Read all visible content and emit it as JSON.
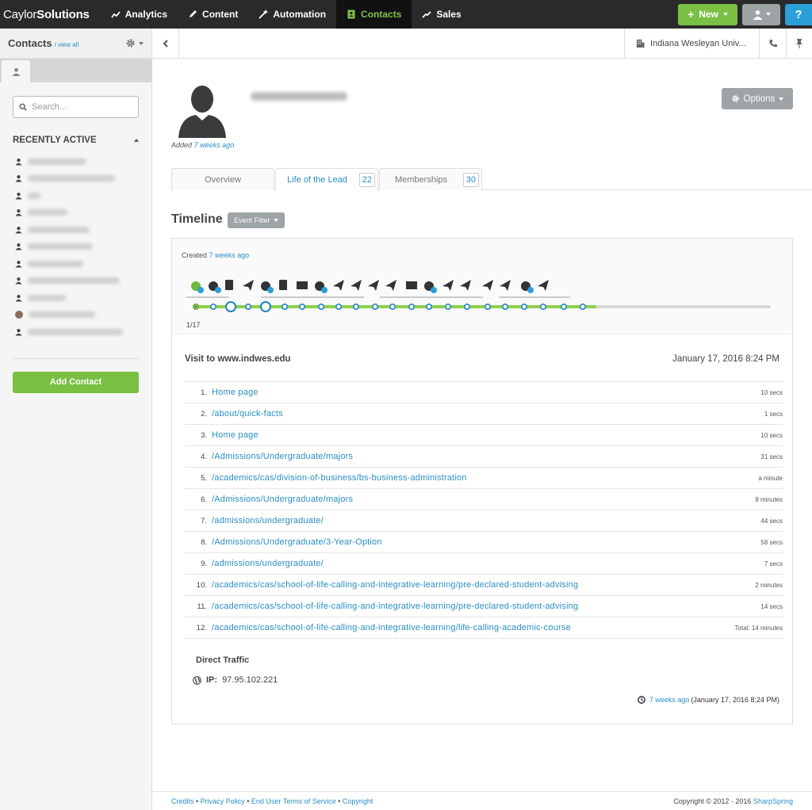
{
  "app": {
    "brand_light": "Caylor",
    "brand_bold": "Solutions"
  },
  "nav": {
    "items": [
      {
        "label": "Analytics",
        "icon": "chart-icon"
      },
      {
        "label": "Content",
        "icon": "pencil-icon"
      },
      {
        "label": "Automation",
        "icon": "wand-icon"
      },
      {
        "label": "Contacts",
        "icon": "contacts-book-icon",
        "active": true
      },
      {
        "label": "Sales",
        "icon": "trend-icon"
      }
    ],
    "new_label": "New",
    "help_label": "?"
  },
  "sidebar": {
    "title": "Contacts",
    "view_all": "/ view all",
    "search_placeholder": "Search...",
    "section_title": "RECENTLY ACTIVE",
    "add_contact": "Add Contact"
  },
  "header": {
    "organization": "Indiana Wesleyan Univ..."
  },
  "contact": {
    "added_prefix": "Added",
    "added_ago": "7 weeks ago",
    "options_label": "Options"
  },
  "tabs": [
    {
      "label": "Overview",
      "count": ""
    },
    {
      "label": "Life of the Lead",
      "count": "22"
    },
    {
      "label": "Memberships",
      "count": "30"
    }
  ],
  "timeline": {
    "title": "Timeline",
    "filter_label": "Event Filter",
    "created_prefix": "Created",
    "created_ago": "7 weeks ago",
    "pager": "1/17"
  },
  "visit": {
    "title": "Visit to www.indwes.edu",
    "date": "January 17, 2016 8:24 PM",
    "pages": [
      {
        "n": "1.",
        "url": "Home page",
        "dur": "10 secs"
      },
      {
        "n": "2.",
        "url": "/about/quick-facts",
        "dur": "1 secs"
      },
      {
        "n": "3.",
        "url": "Home page",
        "dur": "10 secs"
      },
      {
        "n": "4.",
        "url": "/Admissions/Undergraduate/majors",
        "dur": "31 secs"
      },
      {
        "n": "5.",
        "url": "/academics/cas/division-of-business/bs-business-administration",
        "dur": "a minute"
      },
      {
        "n": "6.",
        "url": "/Admissions/Undergraduate/majors",
        "dur": "8 minutes"
      },
      {
        "n": "7.",
        "url": "/admissions/undergraduate/",
        "dur": "44 secs"
      },
      {
        "n": "8.",
        "url": "/Admissions/Undergraduate/3-Year-Option",
        "dur": "58 secs"
      },
      {
        "n": "9.",
        "url": "/admissions/undergraduate/",
        "dur": "7 secs"
      },
      {
        "n": "10.",
        "url": "/academics/cas/school-of-life-calling-and-integrative-learning/pre-declared-student-advising",
        "dur": "2 minutes"
      },
      {
        "n": "11.",
        "url": "/academics/cas/school-of-life-calling-and-integrative-learning/pre-declared-student-advising",
        "dur": "14 secs"
      },
      {
        "n": "12.",
        "url": "/academics/cas/school-of-life-calling-and-integrative-learning/life-calling-academic-course",
        "dur": "Total: 14 minutes"
      }
    ],
    "traffic_label": "Direct Traffic",
    "ip_label": "IP:",
    "ip_value": "97.95.102.221",
    "ago_link": "7 weeks ago",
    "ago_full": "(January 17, 2016 8:24 PM)"
  },
  "footer": {
    "credits": "Credits",
    "privacy": "Privacy Policy",
    "terms": "End User Terms of Service",
    "copyright_link": "Copyright",
    "copy_text": "Copyright © 2012 - 2016",
    "copy_brand": "SharpSpring"
  },
  "colors": {
    "accent_green": "#7ac043",
    "link_blue": "#2a8ec6",
    "nav_bg": "#2a2a2a"
  }
}
